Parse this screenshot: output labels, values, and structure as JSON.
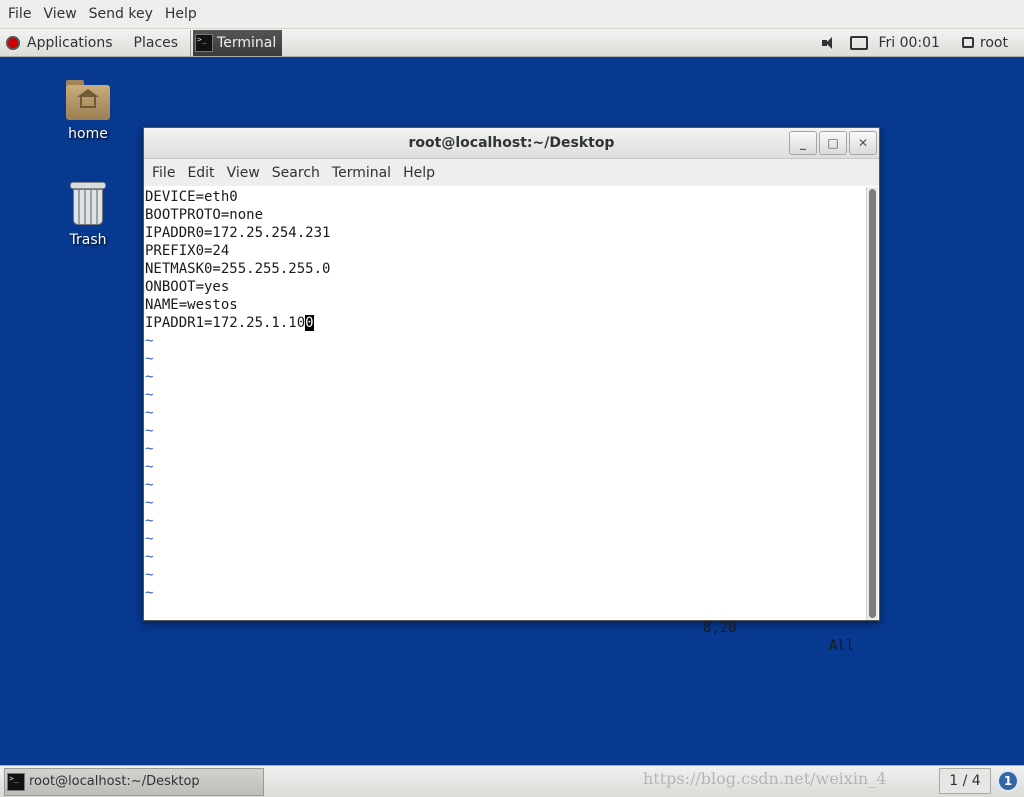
{
  "viewer_menu": [
    "File",
    "View",
    "Send key",
    "Help"
  ],
  "top_panel": {
    "applications": "Applications",
    "places": "Places",
    "task": "Terminal",
    "clock": "Fri 00:01",
    "user": "root"
  },
  "desktop": {
    "icons": [
      {
        "label": "home",
        "icon": "home-folder-icon"
      },
      {
        "label": "Trash",
        "icon": "trash-icon"
      }
    ]
  },
  "window": {
    "title": "root@localhost:~/Desktop",
    "buttons": {
      "minimize": "_",
      "maximize": "□",
      "close": "✕"
    },
    "menu": [
      "File",
      "Edit",
      "View",
      "Search",
      "Terminal",
      "Help"
    ],
    "file_lines": [
      "DEVICE=eth0",
      "BOOTPROTO=none",
      "IPADDR0=172.25.254.231",
      "PREFIX0=24",
      "NETMASK0=255.255.255.0",
      "ONBOOT=yes",
      "NAME=westos"
    ],
    "cursor_line": {
      "before": "IPADDR1=172.25.1.10",
      "cursor_char": "0"
    },
    "tilde_count": 15,
    "tilde_char": "~",
    "status": {
      "position": "8,20",
      "scroll": "All"
    }
  },
  "bottom_panel": {
    "task": "root@localhost:~/Desktop",
    "watermark": "https://blog.csdn.net/weixin_4",
    "pager": "1 / 4",
    "info": "1"
  }
}
